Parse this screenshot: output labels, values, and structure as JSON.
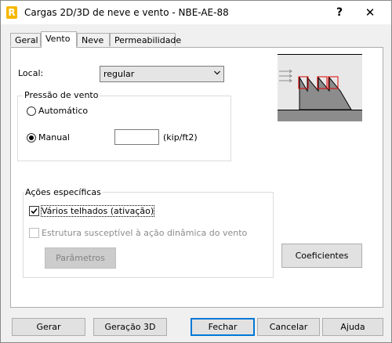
{
  "window": {
    "title": "Cargas 2D/3D de neve e vento - NBE-AE-88",
    "app_icon_letter": "R",
    "help_glyph": "?",
    "close_glyph": "✕"
  },
  "tabs": [
    {
      "label": "Geral"
    },
    {
      "label": "Vento"
    },
    {
      "label": "Neve"
    },
    {
      "label": "Permeabilidade"
    }
  ],
  "local": {
    "label": "Local:",
    "selected": "regular"
  },
  "pressure_group": {
    "legend": "Pressão de vento",
    "auto_label": "Automático",
    "manual_label": "Manual",
    "manual_value": "",
    "unit": "(kip/ft2)",
    "selected": "manual"
  },
  "actions_group": {
    "legend": "Ações específicas",
    "multiple_roofs_label": "Vários telhados (ativação)",
    "multiple_roofs_checked": true,
    "dynamic_label": "Estrutura susceptível à ação dinâmica do vento",
    "dynamic_checked": false,
    "params_button": "Parâmetros"
  },
  "coef_button": "Coeficientes",
  "footer": {
    "gerar": "Gerar",
    "geracao3d": "Geração 3D",
    "fechar": "Fechar",
    "cancelar": "Cancelar",
    "ajuda": "Ajuda"
  },
  "colors": {
    "accent": "#0078d7",
    "diagram_wall": "#8c8c8c",
    "diagram_highlight": "#e00000"
  }
}
